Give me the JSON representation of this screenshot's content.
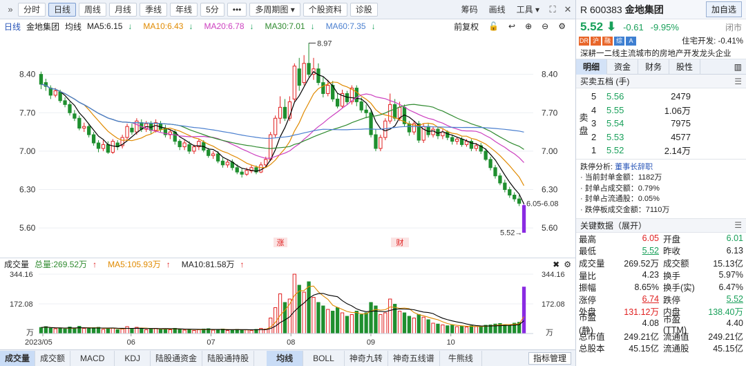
{
  "toolbar": {
    "buttons": [
      "分时",
      "日线",
      "周线",
      "月线",
      "季线",
      "年线",
      "5分",
      "•••",
      "多周期图",
      "个股资料",
      "诊股"
    ],
    "active": "日线",
    "right_items": [
      "筹码",
      "画线",
      "工具"
    ]
  },
  "infobar": {
    "period": "日线",
    "name": "金地集团",
    "ma_label": "均线",
    "ma5": "MA5:6.15",
    "ma10": "MA10:6.43",
    "ma20": "MA20:6.78",
    "ma30": "MA30:7.01",
    "ma60": "MA60:7.35",
    "adjust": "前复权",
    "colors": {
      "ma5": "#000000",
      "ma10": "#e08a00",
      "ma20": "#cc3fbf",
      "ma30": "#2f8a2f",
      "ma60": "#4a7fcf"
    }
  },
  "volume_bar": {
    "title": "成交量",
    "total": "总量:269.52万",
    "ma5": "MA5:105.93万",
    "ma10": "MA10:81.58万"
  },
  "tabs": {
    "items": [
      "成交量",
      "成交额",
      "MACD",
      "KDJ",
      "陆股通资金",
      "陆股通持股"
    ],
    "items2": [
      "均线",
      "BOLL",
      "神奇九转",
      "神奇五线谱",
      "牛熊线"
    ],
    "manager": "指标管理"
  },
  "quote": {
    "code": "R 600383",
    "name": "金地集团",
    "add_button": "加自选",
    "price": "5.52",
    "change": "-0.61",
    "change_pct": "-9.95%",
    "status": "闭市",
    "sector": "住宅开发: -0.41%",
    "tags": [
      "DR",
      "沪",
      "融",
      "综",
      "A"
    ],
    "desc": "深耕一二线主流城市的房地产开发龙头企业"
  },
  "detail_tabs": [
    "明细",
    "资金",
    "财务",
    "股性"
  ],
  "order_book": {
    "title": "买卖五档 (手)",
    "side_label": [
      "卖",
      "盘"
    ],
    "rows": [
      {
        "level": "5",
        "price": "5.56",
        "vol": "2479"
      },
      {
        "level": "4",
        "price": "5.55",
        "vol": "1.06万"
      },
      {
        "level": "3",
        "price": "5.54",
        "vol": "7975"
      },
      {
        "level": "2",
        "price": "5.53",
        "vol": "4577"
      },
      {
        "level": "1",
        "price": "5.52",
        "vol": "2.14万"
      }
    ]
  },
  "limit_analysis": {
    "title": "跌停分析:",
    "reason": "董事长辞职",
    "lines": [
      "当前封单金额：1182万",
      "封单占成交额：0.79%",
      "封单占流通股：0.05%",
      "跌停板成交金额：7110万"
    ]
  },
  "key_data": {
    "title": "关键数据（展开）",
    "rows": [
      [
        "最高",
        "6.05",
        "开盘",
        "6.01"
      ],
      [
        "最低",
        "5.52",
        "昨收",
        "6.13"
      ],
      [
        "成交量",
        "269.52万",
        "成交额",
        "15.13亿"
      ],
      [
        "量比",
        "4.23",
        "换手",
        "5.97%"
      ],
      [
        "振幅",
        "8.65%",
        "换手(实)",
        "6.47%"
      ],
      [
        "涨停",
        "6.74",
        "跌停",
        "5.52"
      ],
      [
        "外盘",
        "131.12万",
        "内盘",
        "138.40万"
      ],
      [
        "市盈(静)",
        "4.08",
        "市盈(TTM)",
        "4.40"
      ],
      [
        "总市值",
        "249.21亿",
        "流通值",
        "249.21亿"
      ],
      [
        "总股本",
        "45.15亿",
        "流通股",
        "45.15亿"
      ]
    ]
  },
  "chart_data": {
    "type": "candlestick",
    "price_axis": {
      "ticks": [
        "8.40",
        "7.70",
        "7.00",
        "6.30",
        "5.60"
      ],
      "ylim": [
        5.25,
        9.05
      ]
    },
    "volume_axis": {
      "ticks": [
        "344.16",
        "172.08",
        "万"
      ],
      "ylim": [
        0,
        344.16
      ]
    },
    "x_labels": [
      "2023/05",
      "06",
      "07",
      "08",
      "09",
      "10"
    ],
    "annotations": {
      "high": "8.97",
      "range": "6.05-6.08",
      "last": "5.52",
      "event1": "涨",
      "event2": "财"
    },
    "candles": [
      [
        8.4,
        8.22,
        8.45,
        8.13,
        35
      ],
      [
        8.25,
        8.18,
        8.32,
        8.1,
        40
      ],
      [
        8.15,
        8.02,
        8.2,
        7.95,
        30
      ],
      [
        8.02,
        8.1,
        8.15,
        7.98,
        28
      ],
      [
        8.08,
        7.92,
        8.12,
        7.88,
        32
      ],
      [
        7.92,
        7.85,
        7.98,
        7.8,
        27
      ],
      [
        7.85,
        7.7,
        7.9,
        7.65,
        38
      ],
      [
        7.68,
        7.6,
        7.75,
        7.55,
        30
      ],
      [
        7.6,
        7.42,
        7.65,
        7.38,
        42
      ],
      [
        7.42,
        7.45,
        7.52,
        7.35,
        30
      ],
      [
        7.45,
        7.3,
        7.5,
        7.25,
        28
      ],
      [
        7.3,
        7.15,
        7.35,
        7.1,
        34
      ],
      [
        7.15,
        7.05,
        7.2,
        6.98,
        36
      ],
      [
        7.05,
        7.12,
        7.2,
        7.0,
        24
      ],
      [
        7.12,
        6.98,
        7.18,
        6.95,
        30
      ],
      [
        6.98,
        7.18,
        7.22,
        6.95,
        32
      ],
      [
        7.15,
        7.08,
        7.2,
        7.02,
        22
      ],
      [
        7.1,
        7.25,
        7.3,
        7.05,
        26
      ],
      [
        7.25,
        7.45,
        7.5,
        7.2,
        40
      ],
      [
        7.42,
        7.35,
        7.5,
        7.3,
        28
      ],
      [
        7.35,
        7.55,
        7.6,
        7.3,
        36
      ],
      [
        7.52,
        7.4,
        7.58,
        7.35,
        30
      ],
      [
        7.4,
        7.5,
        7.55,
        7.35,
        22
      ],
      [
        7.5,
        7.38,
        7.55,
        7.32,
        26
      ],
      [
        7.38,
        7.52,
        7.58,
        7.34,
        30
      ],
      [
        7.5,
        7.4,
        7.55,
        7.35,
        24
      ],
      [
        7.42,
        7.3,
        7.48,
        7.25,
        28
      ],
      [
        7.3,
        7.35,
        7.4,
        7.22,
        22
      ],
      [
        7.35,
        7.18,
        7.4,
        7.12,
        30
      ],
      [
        7.18,
        7.08,
        7.22,
        7.02,
        26
      ],
      [
        7.08,
        7.15,
        7.2,
        7.02,
        20
      ],
      [
        7.12,
        7.0,
        7.18,
        6.95,
        24
      ],
      [
        7.0,
        7.08,
        7.12,
        6.95,
        18
      ],
      [
        7.08,
        7.18,
        7.22,
        7.02,
        22
      ],
      [
        7.16,
        7.02,
        7.2,
        6.98,
        26
      ],
      [
        7.02,
        6.92,
        7.06,
        6.88,
        28
      ],
      [
        6.92,
        6.95,
        7.0,
        6.86,
        20
      ],
      [
        6.95,
        6.82,
        7.0,
        6.78,
        24
      ],
      [
        6.82,
        6.75,
        6.88,
        6.7,
        26
      ],
      [
        6.75,
        6.8,
        6.84,
        6.7,
        18
      ],
      [
        6.8,
        6.7,
        6.85,
        6.65,
        22
      ],
      [
        6.7,
        6.62,
        6.76,
        6.58,
        24
      ],
      [
        6.62,
        6.58,
        6.68,
        6.52,
        20
      ],
      [
        6.58,
        6.65,
        6.7,
        6.55,
        22
      ],
      [
        6.64,
        6.7,
        6.75,
        6.6,
        18
      ],
      [
        6.7,
        6.62,
        6.74,
        6.58,
        24
      ],
      [
        6.62,
        6.75,
        6.8,
        6.6,
        30
      ],
      [
        6.75,
        6.85,
        6.9,
        6.72,
        26
      ],
      [
        6.85,
        7.3,
        7.35,
        6.82,
        90
      ],
      [
        7.3,
        7.6,
        7.65,
        7.25,
        150
      ],
      [
        7.6,
        7.8,
        8.0,
        7.5,
        230
      ],
      [
        7.8,
        7.6,
        7.95,
        7.55,
        180
      ],
      [
        7.6,
        7.9,
        8.0,
        7.55,
        200
      ],
      [
        7.95,
        8.55,
        8.6,
        7.9,
        344
      ],
      [
        8.5,
        8.2,
        8.7,
        8.1,
        280
      ],
      [
        8.25,
        8.6,
        8.75,
        8.2,
        240
      ],
      [
        8.6,
        8.4,
        8.97,
        8.35,
        300
      ],
      [
        8.4,
        8.5,
        8.7,
        8.3,
        210
      ],
      [
        8.5,
        8.25,
        8.6,
        8.2,
        180
      ],
      [
        8.25,
        8.05,
        8.35,
        7.98,
        160
      ],
      [
        8.05,
        8.2,
        8.3,
        8.0,
        140
      ],
      [
        8.2,
        7.95,
        8.28,
        7.9,
        130
      ],
      [
        7.95,
        7.82,
        8.05,
        7.78,
        150
      ],
      [
        7.82,
        8.05,
        8.12,
        7.78,
        120
      ],
      [
        8.05,
        7.9,
        8.1,
        7.85,
        100
      ],
      [
        7.9,
        8.15,
        8.2,
        7.85,
        110
      ],
      [
        8.15,
        7.9,
        8.2,
        7.82,
        130
      ],
      [
        7.9,
        7.75,
        7.98,
        7.7,
        110
      ],
      [
        7.75,
        7.7,
        7.85,
        7.6,
        120
      ],
      [
        7.7,
        7.3,
        7.75,
        7.25,
        180
      ],
      [
        7.3,
        7.05,
        7.4,
        7.0,
        160
      ],
      [
        7.05,
        7.25,
        7.3,
        7.0,
        110
      ],
      [
        7.25,
        7.55,
        7.6,
        7.2,
        120
      ],
      [
        7.55,
        7.85,
        8.05,
        7.5,
        200
      ],
      [
        7.85,
        7.6,
        7.95,
        7.55,
        170
      ],
      [
        7.6,
        7.8,
        7.9,
        7.55,
        130
      ],
      [
        7.8,
        7.5,
        7.85,
        7.45,
        120
      ],
      [
        7.5,
        7.35,
        7.55,
        7.28,
        100
      ],
      [
        7.35,
        7.5,
        7.55,
        7.3,
        90
      ],
      [
        7.5,
        7.2,
        7.55,
        7.15,
        110
      ],
      [
        7.2,
        7.45,
        7.5,
        7.15,
        95
      ],
      [
        7.45,
        7.3,
        7.5,
        7.25,
        80
      ],
      [
        7.3,
        7.4,
        7.45,
        7.25,
        60
      ],
      [
        7.4,
        7.28,
        7.45,
        7.22,
        55
      ],
      [
        7.28,
        7.35,
        7.4,
        7.22,
        50
      ],
      [
        7.35,
        7.25,
        7.38,
        7.2,
        45
      ],
      [
        7.25,
        7.18,
        7.3,
        7.12,
        48
      ],
      [
        7.18,
        7.22,
        7.26,
        7.12,
        40
      ],
      [
        7.22,
        7.12,
        7.26,
        7.08,
        42
      ],
      [
        7.12,
        7.18,
        7.22,
        7.08,
        38
      ],
      [
        7.18,
        7.05,
        7.22,
        7.0,
        45
      ],
      [
        7.05,
        7.1,
        7.15,
        7.0,
        40
      ],
      [
        7.1,
        7.0,
        7.15,
        6.95,
        42
      ],
      [
        7.0,
        6.85,
        7.05,
        6.82,
        48
      ],
      [
        6.85,
        6.7,
        6.9,
        6.65,
        50
      ],
      [
        6.7,
        6.55,
        6.75,
        6.5,
        55
      ],
      [
        6.55,
        6.42,
        6.6,
        6.38,
        58
      ],
      [
        6.42,
        6.3,
        6.48,
        6.25,
        50
      ],
      [
        6.3,
        6.2,
        6.35,
        6.15,
        45
      ],
      [
        6.2,
        6.13,
        6.25,
        6.08,
        60
      ],
      [
        6.13,
        6.05,
        6.2,
        6.0,
        65
      ],
      [
        6.01,
        5.52,
        6.05,
        5.52,
        269.52
      ]
    ]
  }
}
